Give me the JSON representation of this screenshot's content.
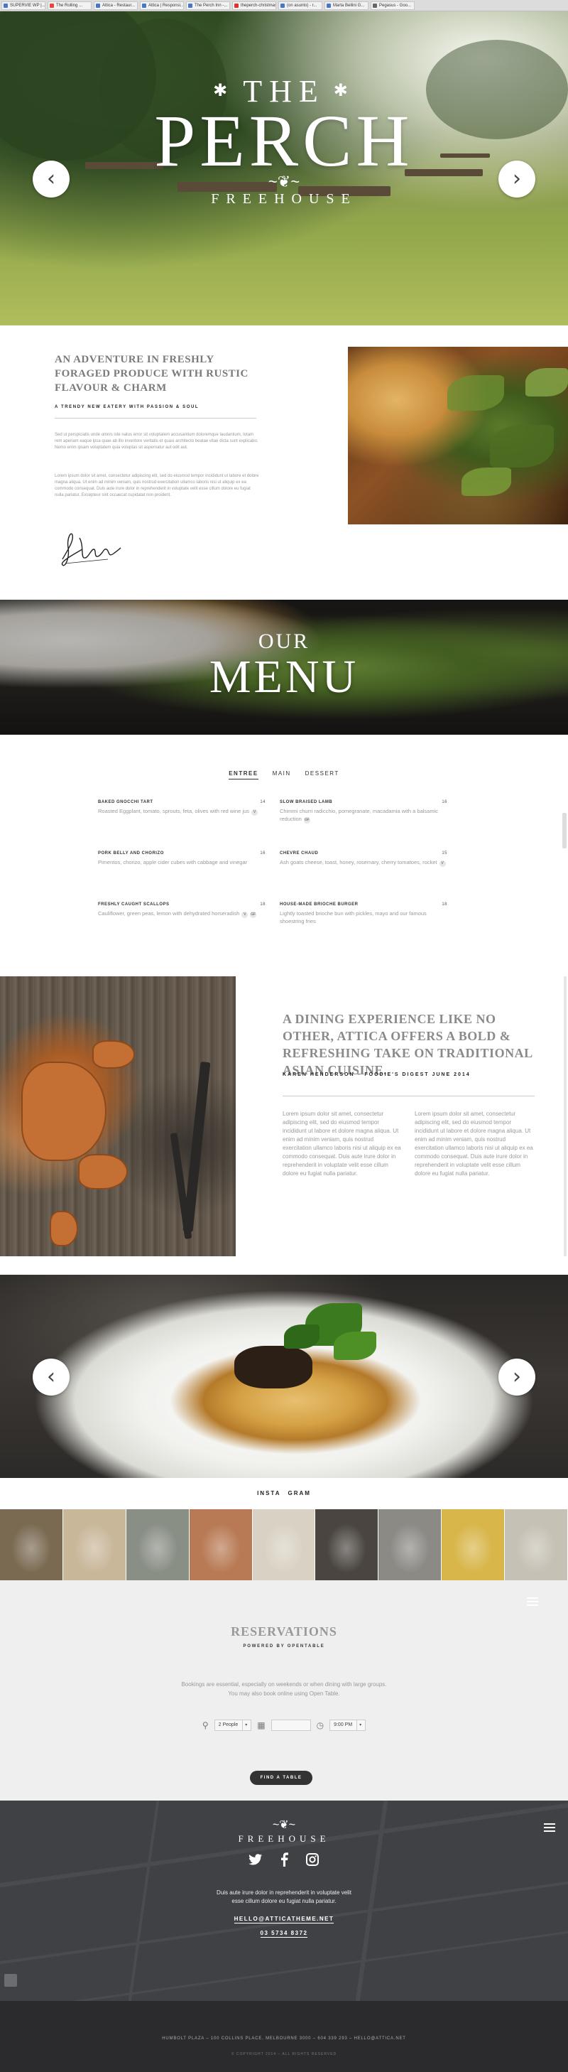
{
  "browser": {
    "tabs": [
      "SUPERVIE WP |...",
      "The Rolling ...",
      "Attica - Restaur...",
      "Attica | Responsi...",
      "The Perch Inn -...",
      "theperch-christmas...",
      "(on asunto) - r...",
      "Marta Bellini G...",
      "Pegasus - Goo..."
    ]
  },
  "hero": {
    "the": "THE",
    "star": "✱",
    "name": "PERCH",
    "swirl": "~❦~",
    "sub": "FREEHOUSE",
    "prev_icon": "chevron-left-icon",
    "next_icon": "chevron-right-icon"
  },
  "about": {
    "title": "AN ADVENTURE IN FRESHLY FORAGED PRODUCE WITH RUSTIC FLAVOUR & CHARM",
    "tagline": "A TRENDY NEW EATERY WITH PASSION & SOUL",
    "p1": "Sed ut perspiciatis unde omnis iste natus error sit voluptatem accusantium doloremque laudantium, totam rem aperiam eaque ipsa quae ab illo inventore veritatis et quasi architecto beatae vitae dicta sunt explicabo. Nemo enim ipsam voluptatem quia voluptas sit aspernatur aut odit aut.",
    "p2": "Lorem ipsum dolor sit amet, consectetur adipiscing elit, sed do eiusmod tempor incididunt ut labore et dolore magna aliqua. Ut enim ad minim veniam, quis nostrud exercitation ullamco laboris nisi ut aliquip ex ea commodo consequat. Duis aute irure dolor in reprehenderit in voluptate velit esse cillum dolore eu fugiat nulla pariatur. Excepteur sint occaecat cupidatat non proident."
  },
  "menu_banner": {
    "our": "OUR",
    "menu": "MENU"
  },
  "menu": {
    "tabs": [
      "ENTREE",
      "MAIN",
      "DESSERT"
    ],
    "items": [
      {
        "name": "BAKED GNOCCHI TART",
        "price": "14",
        "desc": "Roasted Eggplant, tomato, sprouts, feta, olives with red wine jus",
        "badges": [
          "V"
        ]
      },
      {
        "name": "SLOW BRAISED LAMB",
        "price": "16",
        "desc": "Chimmi churri radicchio, pomegranate, macadamia with a balsamic reduction",
        "badges": [
          "GF"
        ]
      },
      {
        "name": "PORK BELLY AND CHORIZO",
        "price": "16",
        "desc": "Pimentos, chorizo, apple cider cubes with cabbage and vinegar",
        "badges": []
      },
      {
        "name": "CHEVRE CHAUD",
        "price": "15",
        "desc": "Ash goats cheese, toast, honey, rosemary, cherry tomatoes, rocket",
        "badges": [
          "V"
        ]
      },
      {
        "name": "FRESHLY CAUGHT SCALLOPS",
        "price": "18",
        "desc": "Cauliflower, green peas, lemon with dehydrated horseradish",
        "badges": [
          "V",
          "GF"
        ]
      },
      {
        "name": "HOUSE-MADE BRIOCHE BURGER",
        "price": "18",
        "desc": "Lightly toasted brioche bun with pickles, mayo and our famous shoestring fries",
        "badges": []
      }
    ]
  },
  "dining": {
    "title": "A DINING EXPERIENCE LIKE NO OTHER, ATTICA OFFERS A BOLD & REFRESHING TAKE ON TRADITIONAL ASIAN CUISINE.",
    "cite": "KAREN HENDERSON – FOODIE'S DIGEST JUNE 2014",
    "col1": "Lorem ipsum dolor sit amet, consectetur adipiscing elit, sed do eiusmod tempor incididunt ut labore et dolore magna aliqua. Ut enim ad minim veniam, quis nostrud exercitation ullamco laboris nisi ut aliquip ex ea commodo consequat. Duis aute irure dolor in reprehenderit in voluptate velit esse cillum dolore eu fugiat nulla pariatur.",
    "col2": "Lorem ipsum dolor sit amet, consectetur adipiscing elit, sed do eiusmod tempor incididunt ut labore et dolore magna aliqua. Ut enim ad minim veniam, quis nostrud exercitation ullamco laboris nisi ut aliquip ex ea commodo consequat. Duis aute irure dolor in reprehenderit in voluptate velit esse cillum dolore eu fugiat nulla pariatur."
  },
  "insta": {
    "left": "INSTA",
    "right": "GRAM",
    "tiles": [
      "#7a6a52",
      "#c9b79a",
      "#8a8f86",
      "#b87a54",
      "#d9d2c4",
      "#4a4540",
      "#8c8a85",
      "#d8b64a",
      "#c6c1b5"
    ]
  },
  "reservations": {
    "title": "RESERVATIONS",
    "powered": "POWERED BY OPENTABLE",
    "p1": "Bookings are essential, especially on weekends or when dining with large groups.",
    "p2": "You may also book online using Open Table.",
    "people": "2 People",
    "date": "",
    "time": "9:00 PM",
    "button": "FIND A TABLE"
  },
  "footer": {
    "swirl": "~❦~",
    "name": "FREEHOUSE",
    "text1": "Duis aute irure dolor in reprehenderit in voluptate velit",
    "text2": "esse cillum dolore eu fugiat nulla pariatur.",
    "email": "HELLO@ATTICATHEME.NET",
    "phone": "03 5734 8372",
    "address": "HUMBOLT PLAZA – 100 COLLINS PLACE, MELBOURNE 3000 – 604 339 293 – HELLO@ATTICA.NET",
    "copyright": "© COPYRIGHT 2014 – ALL RIGHTS RESERVED"
  }
}
